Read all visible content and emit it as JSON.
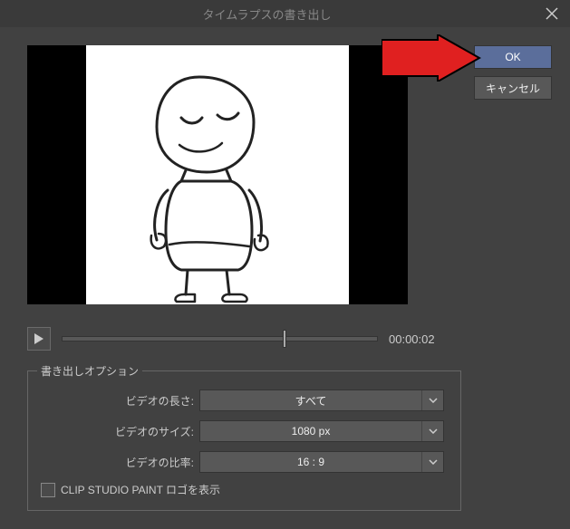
{
  "titlebar": {
    "title": "タイムラプスの書き出し"
  },
  "buttons": {
    "ok": "OK",
    "cancel": "キャンセル"
  },
  "transport": {
    "timecode": "00:00:02"
  },
  "options": {
    "legend": "書き出しオプション",
    "length_label": "ビデオの長さ:",
    "length_value": "すべて",
    "size_label": "ビデオのサイズ:",
    "size_value": "1080 px",
    "ratio_label": "ビデオの比率:",
    "ratio_value": "16 : 9",
    "logo_label": "CLIP STUDIO PAINT ロゴを表示"
  }
}
